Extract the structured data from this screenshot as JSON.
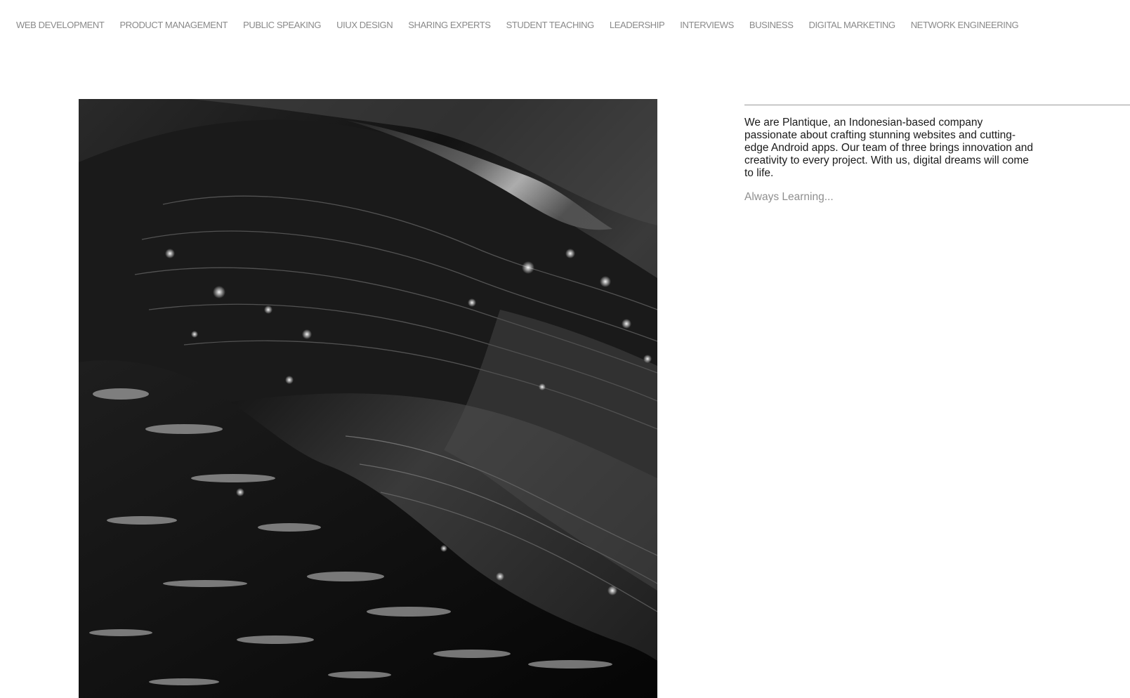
{
  "nav": {
    "items": [
      {
        "label": "WEB DEVELOPMENT"
      },
      {
        "label": "PRODUCT MANAGEMENT"
      },
      {
        "label": "PUBLIC SPEAKING"
      },
      {
        "label": "UIUX DESIGN"
      },
      {
        "label": "SHARING EXPERTS"
      },
      {
        "label": "STUDENT TEACHING"
      },
      {
        "label": "LEADERSHIP"
      },
      {
        "label": "INTERVIEWS"
      },
      {
        "label": "BUSINESS"
      },
      {
        "label": "DIGITAL MARKETING"
      },
      {
        "label": "NETWORK ENGINEERING"
      }
    ]
  },
  "about": {
    "description": "We are Plantique, an Indonesian-based company passionate about crafting stunning websites and cutting-edge Android apps. Our team of three brings innovation and creativity to every project. With us, digital dreams will come to life.",
    "tagline": "Always Learning..."
  },
  "colors": {
    "nav_text": "#8a8a8a",
    "body_text": "#1a1a1a",
    "tagline_text": "#8f8f8f",
    "rule": "#9a9a9a"
  }
}
